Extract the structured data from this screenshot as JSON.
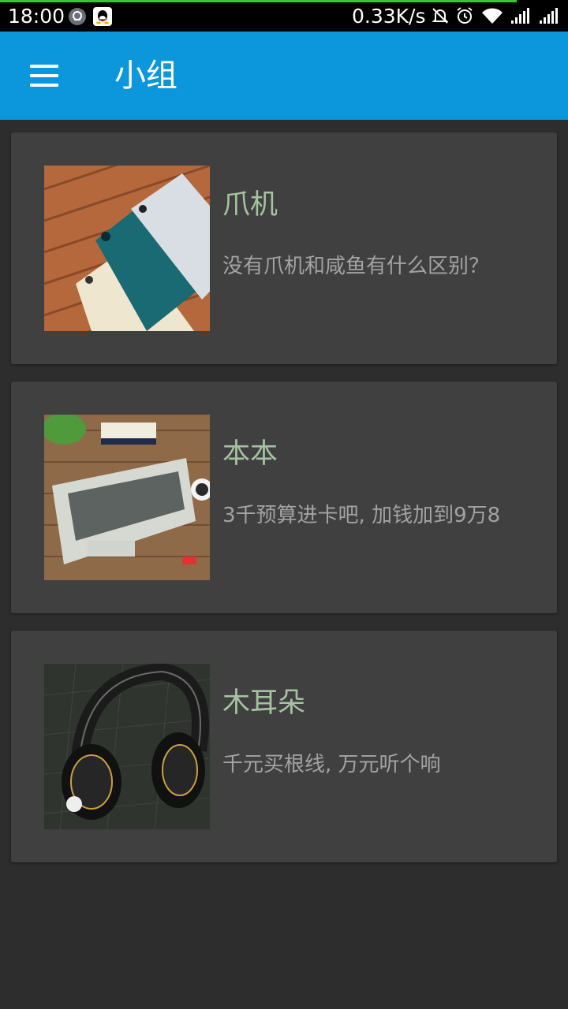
{
  "status_bar": {
    "time": "18:00",
    "net_speed": "0.33K/s",
    "icons": [
      "app-notification-icon",
      "qq-icon",
      "mute-bell-icon",
      "alarm-icon",
      "wifi-icon",
      "signal-icon",
      "signal-icon"
    ]
  },
  "app_bar": {
    "title": "小组",
    "menu_icon": "hamburger-menu-icon",
    "color": "#0c96dc"
  },
  "groups": [
    {
      "title": "爪机",
      "description": "没有爪机和咸鱼有什么区别？",
      "image": "phones-image"
    },
    {
      "title": "本本",
      "description": "3千预算进卡吧, 加钱加到9万8",
      "image": "laptop-image"
    },
    {
      "title": "木耳朵",
      "description": "千元买根线, 万元听个响",
      "image": "headphones-image"
    }
  ],
  "colors": {
    "background": "#2d2d2d",
    "card": "#404040",
    "title_text": "#a5c3a0",
    "desc_text": "#a3a3a3"
  }
}
